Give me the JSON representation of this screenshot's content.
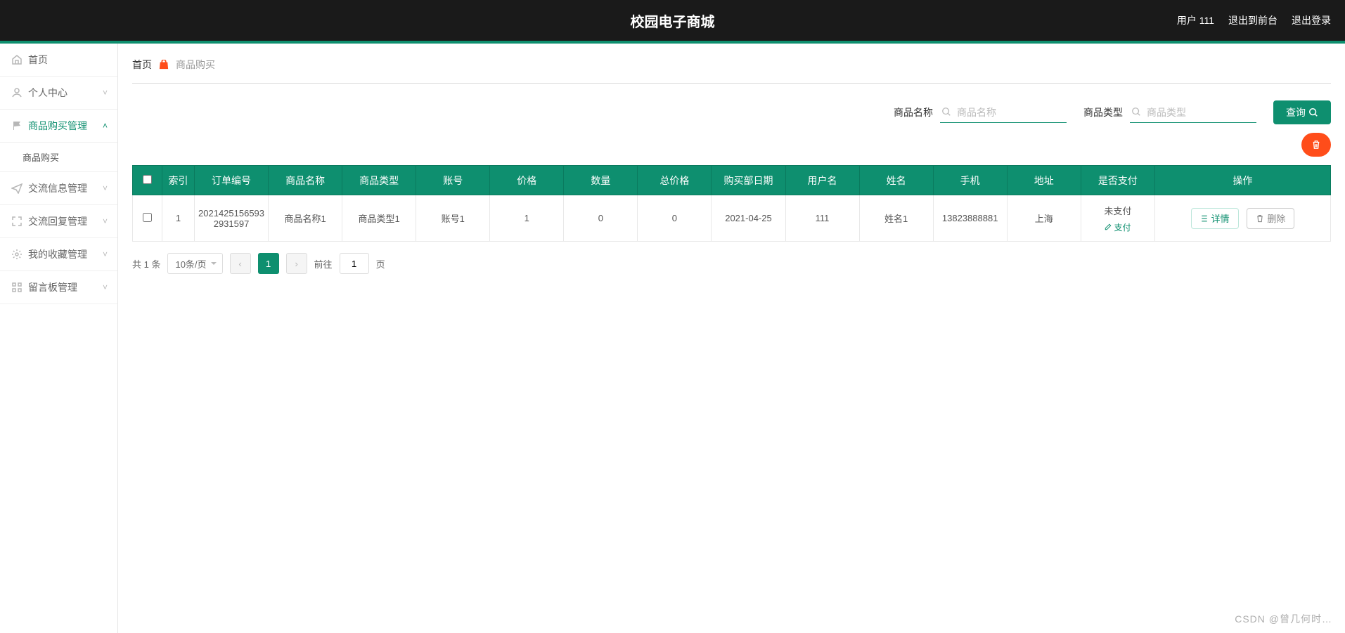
{
  "header": {
    "title": "校园电子商城",
    "user_label": "用户 111",
    "exit_front": "退出到前台",
    "logout": "退出登录"
  },
  "sidebar": {
    "items": [
      {
        "label": "首页",
        "icon": "home",
        "expandable": false
      },
      {
        "label": "个人中心",
        "icon": "user",
        "expandable": true
      },
      {
        "label": "商品购买管理",
        "icon": "flag",
        "expandable": true,
        "open": true,
        "children": [
          "商品购买"
        ]
      },
      {
        "label": "交流信息管理",
        "icon": "send",
        "expandable": true
      },
      {
        "label": "交流回复管理",
        "icon": "fullscreen",
        "expandable": true
      },
      {
        "label": "我的收藏管理",
        "icon": "gear",
        "expandable": true
      },
      {
        "label": "留言板管理",
        "icon": "grid",
        "expandable": true
      }
    ]
  },
  "breadcrumb": {
    "home": "首页",
    "current": "商品购买"
  },
  "filters": {
    "name_label": "商品名称",
    "name_placeholder": "商品名称",
    "type_label": "商品类型",
    "type_placeholder": "商品类型",
    "query_btn": "查询"
  },
  "table": {
    "headers": [
      "索引",
      "订单编号",
      "商品名称",
      "商品类型",
      "账号",
      "价格",
      "数量",
      "总价格",
      "购买部日期",
      "用户名",
      "姓名",
      "手机",
      "地址",
      "是否支付",
      "操作"
    ],
    "rows": [
      {
        "idx": "1",
        "order_no": "20214251565932931597",
        "prod_name": "商品名称1",
        "prod_type": "商品类型1",
        "account": "账号1",
        "price": "1",
        "qty": "0",
        "total": "0",
        "buy_date": "2021-04-25",
        "username": "111",
        "realname": "姓名1",
        "phone": "13823888881",
        "address": "上海",
        "pay_status": "未支付",
        "pay_action": "支付",
        "detail_btn": "详情",
        "delete_btn": "删除"
      }
    ]
  },
  "pager": {
    "total_text": "共 1 条",
    "page_size": "10条/页",
    "current_page": "1",
    "goto_label_pre": "前往",
    "goto_value": "1",
    "goto_label_post": "页"
  },
  "watermark": "CSDN @曾几何时…"
}
